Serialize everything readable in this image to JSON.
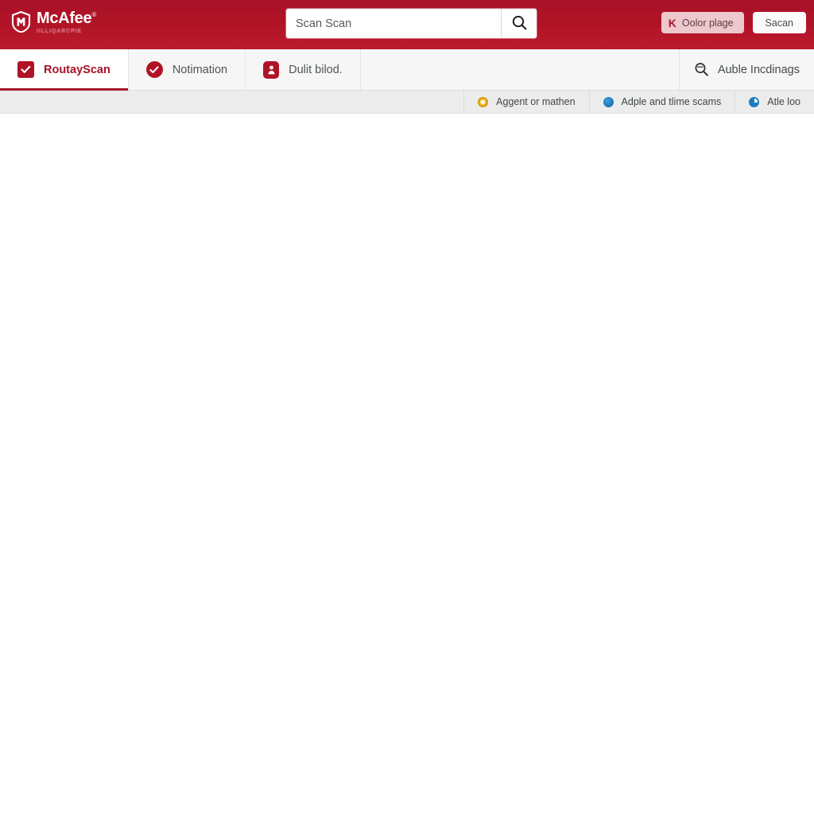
{
  "header": {
    "brand_name": "McAfee",
    "brand_sub": "IILLIQARCPIE",
    "brand_icon": "mcafee-shield-logo",
    "search": {
      "value": "Scan Scan",
      "placeholder": "Scan Scan",
      "icon": "search-icon"
    },
    "actions": [
      {
        "label": "Oolor plage",
        "icon": "k-mark-icon",
        "style": "pink"
      },
      {
        "label": "Sacan",
        "icon": "",
        "style": "white"
      }
    ]
  },
  "tabs": [
    {
      "label": "RoutayScan",
      "icon": "checkbox-square-icon",
      "active": true
    },
    {
      "label": "Notimation",
      "icon": "check-circle-icon",
      "active": false
    },
    {
      "label": "Dulit bilod.",
      "icon": "shield-person-icon",
      "active": false
    }
  ],
  "tab_right": {
    "label": "Auble Incdinags",
    "icon": "magnifier-search-icon"
  },
  "subbar": {
    "items": [
      {
        "label": "Aggent or mathen",
        "icon": "warning-circle-icon",
        "color": "#dc9d10"
      },
      {
        "label": "Adple and tlime scams",
        "icon": "globe-circle-icon",
        "color": "#1d7ec4"
      },
      {
        "label": "Atle loo",
        "icon": "info-circle-icon",
        "color": "#1a7ec2"
      }
    ]
  },
  "colors": {
    "brand_red": "#b01326",
    "header_red": "#a81228",
    "tab_bg": "#f4f4f4",
    "subbar_bg": "#ececec",
    "content_bg": "#ffffff"
  }
}
